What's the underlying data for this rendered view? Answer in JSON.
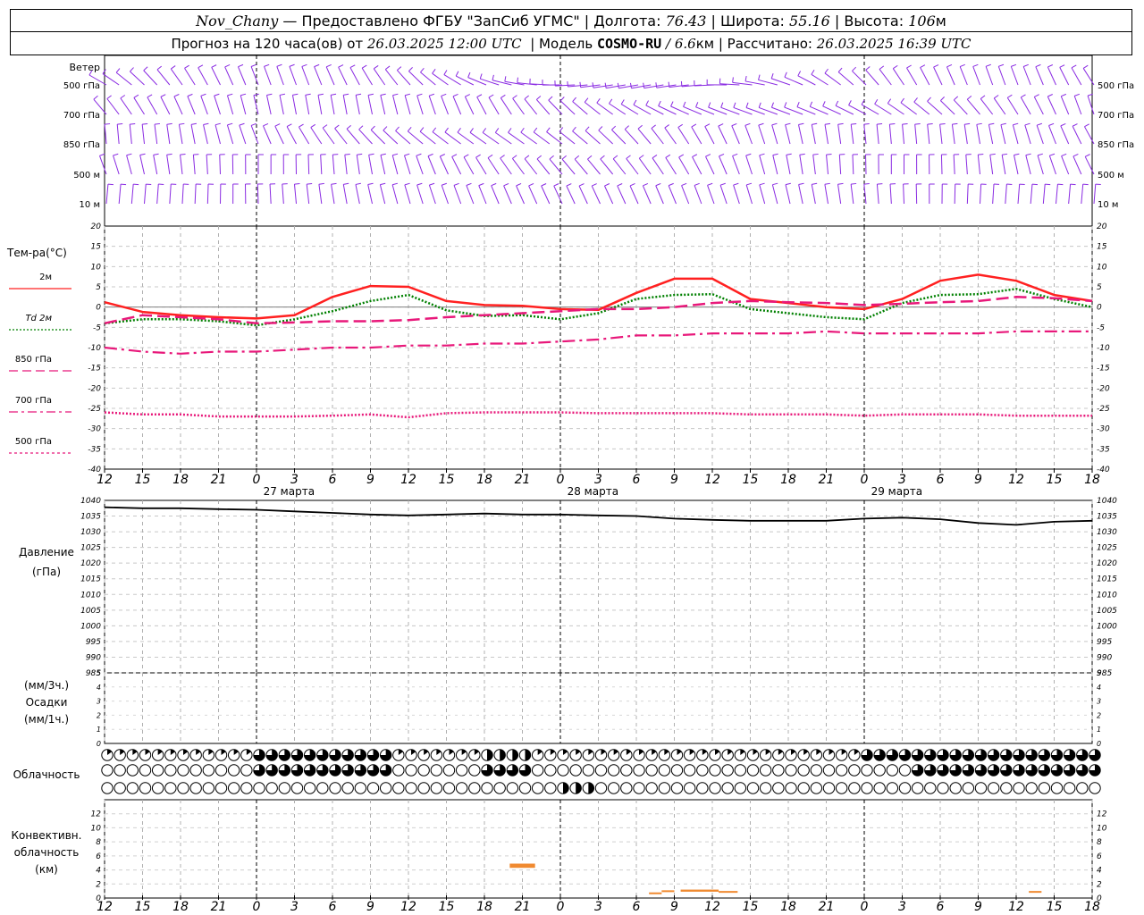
{
  "header": {
    "station": "Nov_Chany",
    "provider": "— Предоставлено ФГБУ \"ЗапСиб УГМС\"",
    "lon_label": "Долгота:",
    "lon_value": "76.43",
    "lat_label": "Широта:",
    "lat_value": "55.16",
    "alt_label": "Высота:",
    "alt_value": "106",
    "alt_unit": "м",
    "forecast_label": "Прогноз на 120 часа(ов) от",
    "forecast_start": "26.03.2025 12:00 UTC",
    "model_label": "Модель",
    "model_name": "COSMO-RU",
    "model_res": "/ 6.6",
    "model_res_unit": "км",
    "calc_label": "Рассчитано:",
    "calc_time": "26.03.2025 16:39 UTC"
  },
  "wind_panel": {
    "title": "Ветер",
    "levels": [
      "500 гПа",
      "700 гПа",
      "850 гПа",
      "500 м",
      "10 м"
    ],
    "color": "#8a2be2"
  },
  "legend": {
    "temp_title": "Тем-ра(°C)",
    "items": [
      {
        "label": "2м",
        "color": "#ff2020",
        "style": "solid"
      },
      {
        "label": "Td 2м",
        "color": "#008000",
        "style": "dotted"
      },
      {
        "label": "850 гПа",
        "color": "#e8187a",
        "style": "dash"
      },
      {
        "label": "700 гПа",
        "color": "#e8187a",
        "style": "dashdot"
      },
      {
        "label": "500 гПа",
        "color": "#e8187a",
        "style": "dot"
      }
    ]
  },
  "pressure_label": [
    "Давление",
    "(гПа)"
  ],
  "precip_label": [
    "(мм/3ч.)",
    "Осадки",
    "(мм/1ч.)"
  ],
  "cloud_label": "Облачность",
  "conv_label": [
    "Конвективн.",
    "облачность",
    "(км)"
  ],
  "time_ticks": [
    "12",
    "15",
    "18",
    "21",
    "0",
    "3",
    "6",
    "9",
    "12",
    "15",
    "18",
    "21",
    "0",
    "3",
    "6",
    "9",
    "12",
    "15",
    "18",
    "21",
    "0",
    "3",
    "6",
    "9",
    "12",
    "15",
    "18"
  ],
  "date_labels": [
    "27 марта",
    "28 марта",
    "29 марта"
  ],
  "chart_data": [
    {
      "type": "line",
      "title": "Тем-ра(°C)",
      "x_hours": [
        0,
        3,
        6,
        9,
        12,
        15,
        18,
        21,
        24,
        27,
        30,
        33,
        36,
        39,
        42,
        45,
        48,
        51,
        54,
        57,
        60,
        63,
        66,
        69,
        72,
        75,
        78
      ],
      "ylim": [
        -40,
        20
      ],
      "yticks": [
        20,
        15,
        10,
        5,
        0,
        -5,
        -10,
        -15,
        -20,
        -25,
        -30,
        -35,
        -40
      ],
      "series": [
        {
          "name": "2м",
          "values": [
            1.2,
            -1.2,
            -2.0,
            -2.5,
            -2.8,
            -2.0,
            2.5,
            5.2,
            5.0,
            1.5,
            0.5,
            0.3,
            -0.5,
            -0.7,
            3.5,
            7.0,
            7.0,
            2.0,
            1.0,
            0.0,
            -0.5,
            2.0,
            6.5,
            8.0,
            6.5,
            3.0,
            1.5
          ]
        },
        {
          "name": "Td 2м",
          "values": [
            -4.0,
            -3.0,
            -3.0,
            -3.5,
            -4.5,
            -3.0,
            -1.0,
            1.5,
            3.0,
            -0.8,
            -2.2,
            -2.0,
            -3.0,
            -1.5,
            2.0,
            3.0,
            3.2,
            -0.5,
            -1.5,
            -2.5,
            -3.0,
            1.0,
            3.0,
            3.2,
            4.5,
            2.0,
            0.0
          ]
        },
        {
          "name": "850 гПа",
          "values": [
            -4.0,
            -2.0,
            -2.5,
            -3.0,
            -4.0,
            -3.8,
            -3.5,
            -3.5,
            -3.2,
            -2.5,
            -2.0,
            -1.5,
            -1.0,
            -0.5,
            -0.5,
            0.0,
            1.0,
            1.5,
            1.2,
            1.0,
            0.5,
            0.8,
            1.2,
            1.5,
            2.5,
            2.2,
            1.5
          ]
        },
        {
          "name": "700 гПа",
          "values": [
            -10.0,
            -11.0,
            -11.5,
            -11.0,
            -11.0,
            -10.5,
            -10.0,
            -10.0,
            -9.5,
            -9.5,
            -9.0,
            -9.0,
            -8.5,
            -8.0,
            -7.0,
            -7.0,
            -6.5,
            -6.5,
            -6.5,
            -6.0,
            -6.5,
            -6.5,
            -6.5,
            -6.5,
            -6.0,
            -6.0,
            -6.0
          ]
        },
        {
          "name": "500 гПа",
          "values": [
            -26.0,
            -26.5,
            -26.5,
            -27.0,
            -27.0,
            -27.0,
            -26.8,
            -26.5,
            -27.2,
            -26.2,
            -26.0,
            -26.0,
            -26.0,
            -26.2,
            -26.2,
            -26.2,
            -26.2,
            -26.5,
            -26.5,
            -26.5,
            -26.8,
            -26.5,
            -26.5,
            -26.5,
            -26.8,
            -26.8,
            -26.8
          ]
        }
      ]
    },
    {
      "type": "line",
      "title": "Давление (гПа)",
      "x_hours": [
        0,
        3,
        6,
        9,
        12,
        15,
        18,
        21,
        24,
        27,
        30,
        33,
        36,
        39,
        42,
        45,
        48,
        51,
        54,
        57,
        60,
        63,
        66,
        69,
        72,
        75,
        78
      ],
      "ylim": [
        985,
        1040
      ],
      "yticks": [
        1040,
        1035,
        1030,
        1025,
        1020,
        1015,
        1010,
        1005,
        1000,
        995,
        990,
        985
      ],
      "series": [
        {
          "name": "",
          "values": [
            1037.8,
            1037.5,
            1037.5,
            1037.2,
            1037.0,
            1036.5,
            1036.0,
            1035.5,
            1035.2,
            1035.5,
            1035.8,
            1035.5,
            1035.5,
            1035.2,
            1035.0,
            1034.2,
            1033.8,
            1033.5,
            1033.5,
            1033.5,
            1034.2,
            1034.5,
            1034.0,
            1032.8,
            1032.2,
            1033.2,
            1033.5
          ]
        }
      ]
    },
    {
      "type": "bar",
      "title": "Осадки (мм/3ч.) (мм/1ч.)",
      "ylim": [
        0,
        5
      ],
      "yticks": [
        5,
        4,
        3,
        2,
        1,
        0
      ],
      "values": []
    },
    {
      "type": "bar",
      "title": "Конвективн. облачность (км)",
      "ylim": [
        0,
        14
      ],
      "yticks": [
        12,
        10,
        8,
        6,
        4,
        2,
        0
      ],
      "segments": [
        {
          "x_start": 32.0,
          "x_end": 34.0,
          "base": 4.3,
          "top": 4.9
        },
        {
          "x_start": 43.0,
          "x_end": 44.0,
          "base": 0.6,
          "top": 0.8
        },
        {
          "x_start": 44.0,
          "x_end": 45.0,
          "base": 0.9,
          "top": 1.1
        },
        {
          "x_start": 45.5,
          "x_end": 48.5,
          "base": 0.9,
          "top": 1.2
        },
        {
          "x_start": 48.5,
          "x_end": 50.0,
          "base": 0.8,
          "top": 1.0
        },
        {
          "x_start": 73.0,
          "x_end": 74.0,
          "base": 0.8,
          "top": 1.0
        }
      ],
      "color": "#f08a30"
    }
  ]
}
